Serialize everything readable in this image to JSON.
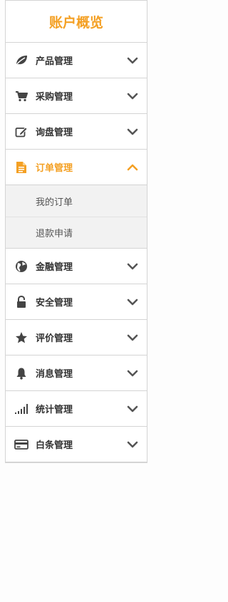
{
  "sidebar": {
    "title": "账户概览",
    "accent_color": "#f4a024",
    "items": [
      {
        "label": "产品管理",
        "icon": "leaf-icon",
        "expanded": false
      },
      {
        "label": "采购管理",
        "icon": "cart-icon",
        "expanded": false
      },
      {
        "label": "询盘管理",
        "icon": "edit-icon",
        "expanded": false
      },
      {
        "label": "订单管理",
        "icon": "document-icon",
        "expanded": true,
        "subitems": [
          {
            "label": "我的订单"
          },
          {
            "label": "退款申请"
          }
        ]
      },
      {
        "label": "金融管理",
        "icon": "globe-icon",
        "expanded": false
      },
      {
        "label": "安全管理",
        "icon": "lock-icon",
        "expanded": false
      },
      {
        "label": "评价管理",
        "icon": "star-icon",
        "expanded": false
      },
      {
        "label": "消息管理",
        "icon": "bell-icon",
        "expanded": false
      },
      {
        "label": "统计管理",
        "icon": "signal-icon",
        "expanded": false
      },
      {
        "label": "白条管理",
        "icon": "credit-card-icon",
        "expanded": false
      }
    ]
  }
}
